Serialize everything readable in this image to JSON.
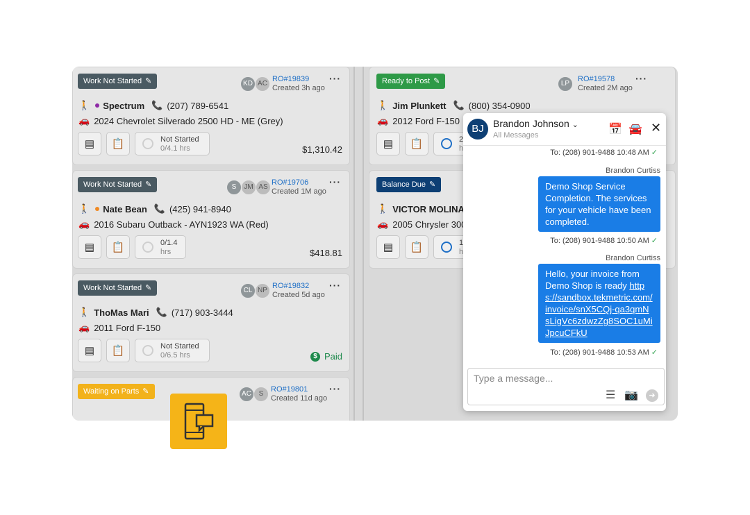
{
  "cards_left": [
    {
      "status": "Work Not Started",
      "status_color": "#4a5a62",
      "avatars": [
        "KD",
        "AC"
      ],
      "ro": "RO#19839",
      "created": "Created 3h ago",
      "customer": "Spectrum",
      "dot_color": "#8e2aa6",
      "phone": "(207) 789-6541",
      "vehicle": "2024 Chevrolet Silverado 2500 HD - ME (Grey)",
      "progress_title": "Not Started",
      "progress_sub": "0/4.1 hrs",
      "amount": "$1,310.42"
    },
    {
      "status": "Work Not Started",
      "status_color": "#4a5a62",
      "avatars": [
        "S",
        "JM",
        "AS"
      ],
      "ro": "RO#19706",
      "created": "Created 1M ago",
      "customer": "Nate Bean",
      "dot_color": "#f08a24",
      "phone": "(425) 941-8940",
      "vehicle": "2016 Subaru Outback - AYN1923 WA (Red)",
      "progress_title": "0/1.4",
      "progress_sub": "hrs",
      "amount": "$418.81"
    },
    {
      "status": "Work Not Started",
      "status_color": "#4a5a62",
      "avatars": [
        "CL",
        "NP"
      ],
      "ro": "RO#19832",
      "created": "Created 5d ago",
      "customer": "ThoMas Mari",
      "phone": "(717) 903-3444",
      "vehicle": "2011 Ford F-150",
      "progress_title": "Not Started",
      "progress_sub": "0/6.5 hrs",
      "paid": "Paid"
    },
    {
      "status": "Waiting on Parts",
      "status_color": "#f2b21b",
      "avatars": [
        "AC",
        "S"
      ],
      "ro": "RO#19801",
      "created": "Created 11d ago"
    }
  ],
  "cards_right": [
    {
      "status": "Ready to Post",
      "status_color": "#2e9a47",
      "avatars": [
        "LP"
      ],
      "ro": "RO#19578",
      "created": "Created 2M ago",
      "customer": "Jim Plunkett",
      "phone": "(800) 354-0900",
      "vehicle": "2012 Ford F-150",
      "progress_title": "2",
      "progress_sub": "h"
    },
    {
      "status": "Balance Due",
      "status_color": "#0d3f74",
      "customer": "VICTOR MOLINA",
      "vehicle": "2005 Chrysler 300",
      "progress_title": "1",
      "progress_sub": "h"
    }
  ],
  "chat": {
    "initials": "BJ",
    "name": "Brandon Johnson",
    "filter": "All Messages",
    "messages": [
      {
        "meta": "To: (208) 901-9488   10:48 AM"
      },
      {
        "sender": "Brandon Curtiss",
        "text": "Demo Shop Service Completion. The services for your vehicle have been completed.",
        "meta": "To: (208) 901-9488   10:50 AM"
      },
      {
        "sender": "Brandon Curtiss",
        "text": "Hello, your invoice from Demo Shop is ready",
        "link": "https://sandbox.tekmetric.com/invoice/snX5CQj-qa3qmNsLigVc6zdwzZg8SOC1uMiJpcuCFkU",
        "meta": "To: (208) 901-9488   10:53 AM"
      }
    ],
    "input_placeholder": "Type a message..."
  }
}
